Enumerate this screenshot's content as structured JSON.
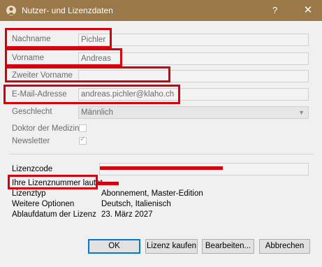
{
  "window": {
    "title": "Nutzer- und Lizenzdaten",
    "help": "?",
    "close": "✕"
  },
  "fields": {
    "nachname": {
      "label": "Nachname",
      "value": "Pichler"
    },
    "vorname": {
      "label": "Vorname",
      "value": "Andreas"
    },
    "zweiter_vorname": {
      "label": "Zweiter Vorname",
      "value": ""
    },
    "email": {
      "label": "E-Mail-Adresse",
      "value": "andreas.pichler@klaho.ch"
    },
    "geschlecht": {
      "label": "Geschlecht",
      "value": "Männlich"
    },
    "doktor": {
      "label": "Doktor der Medizin",
      "checked": false
    },
    "newsletter": {
      "label": "Newsletter",
      "checked": true,
      "check_glyph": "✓"
    }
  },
  "license": {
    "lizenzcode_label": "Lizenzcode",
    "lizenznummer_label": "Ihre Lizenznummer lautet",
    "lizenztyp_label": "Lizenztyp",
    "lizenztyp_value": "Abonnement, Master-Edition",
    "weitere_label": "Weitere Optionen",
    "weitere_value": "Deutsch, Italienisch",
    "ablauf_label": "Ablaufdatum der Lizenz",
    "ablauf_value": "23. März 2027"
  },
  "buttons": {
    "ok": "OK",
    "kaufen": "Lizenz kaufen",
    "bearbeiten": "Bearbeiten...",
    "abbrechen": "Abbrechen"
  },
  "colors": {
    "titlebar": "#9a7847",
    "highlight": "#d6000c"
  }
}
